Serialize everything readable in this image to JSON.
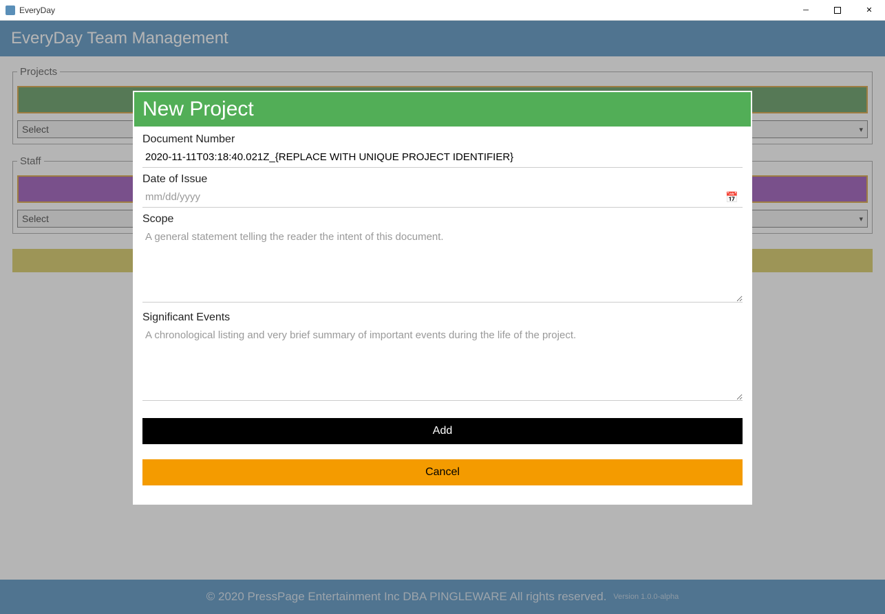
{
  "window": {
    "title": "EveryDay"
  },
  "header": {
    "title": "EveryDay Team Management"
  },
  "sections": {
    "projects": {
      "legend": "Projects",
      "add_label": "",
      "select_placeholder": "Select"
    },
    "staff": {
      "legend": "Staff",
      "add_label": "",
      "select_placeholder": "Select"
    }
  },
  "footer": {
    "copyright": "© 2020 PressPage Entertainment Inc DBA PINGLEWARE  All rights reserved.",
    "version": "Version 1.0.0-alpha"
  },
  "modal": {
    "title": "New Project",
    "fields": {
      "doc_number_label": "Document Number",
      "doc_number_value": "2020-11-11T03:18:40.021Z_{REPLACE WITH UNIQUE PROJECT IDENTIFIER}",
      "date_label": "Date of Issue",
      "date_placeholder": "mm/dd/yyyy",
      "scope_label": "Scope",
      "scope_placeholder": "A general statement telling the reader the intent of this document.",
      "events_label": "Significant Events",
      "events_placeholder": "A chronological listing and very brief summary of important events during the life of the project."
    },
    "buttons": {
      "add": "Add",
      "cancel": "Cancel"
    }
  }
}
